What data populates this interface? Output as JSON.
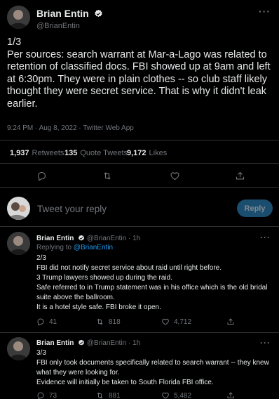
{
  "main_tweet": {
    "author_name": "Brian Entin",
    "author_handle": "@BrianEntin",
    "text": "1/3\nPer sources: search warrant at Mar-a-Lago was related to retention of classified docs. FBI showed up at 9am and left at 6:30pm. They were in plain clothes -- so club staff likely thought they were secret service. That is why it didn't leak earlier.",
    "timestamp": "9:24 PM · Aug 8, 2022 · Twitter Web App",
    "stats": {
      "retweets_count": "1,937",
      "retweets_label": "Retweets",
      "quotes_count": "135",
      "quotes_label": "Quote Tweets",
      "likes_count": "9,172",
      "likes_label": "Likes"
    }
  },
  "compose": {
    "placeholder": "Tweet your reply",
    "reply_button": "Reply"
  },
  "replies": [
    {
      "author_name": "Brian Entin",
      "author_handle": "@BrianEntin",
      "time": "· 1h",
      "replying_prefix": "Replying to",
      "replying_to": "@BrianEntin",
      "text": "2/3\nFBI did not notify secret service about raid until right before.\n3 Trump lawyers showed up during the raid.\nSafe referred to in Trump statement was in his office which is the old bridal suite above the ballroom.\nIt is a hotel style safe. FBI broke it open.",
      "reply_count": "41",
      "retweet_count": "818",
      "like_count": "4,712"
    },
    {
      "author_name": "Brian Entin",
      "author_handle": "@BrianEntin",
      "time": "· 1h",
      "text": "3/3\nFBI only took documents specifically related to search warrant -- they knew what they were looking for.\nEvidence will initially be taken to South Florida FBI office.",
      "reply_count": "73",
      "retweet_count": "881",
      "like_count": "5,482"
    }
  ],
  "icons": {
    "more": "more-icon",
    "verified": "verified-icon",
    "reply": "reply-icon",
    "retweet": "retweet-icon",
    "like": "like-icon",
    "share": "share-icon"
  },
  "colors": {
    "background": "#000000",
    "text": "#e7e9ea",
    "muted": "#71767b",
    "accent": "#1d9bf0",
    "reply_button_bg": "#1a4d6e",
    "divider": "#2f3336"
  }
}
